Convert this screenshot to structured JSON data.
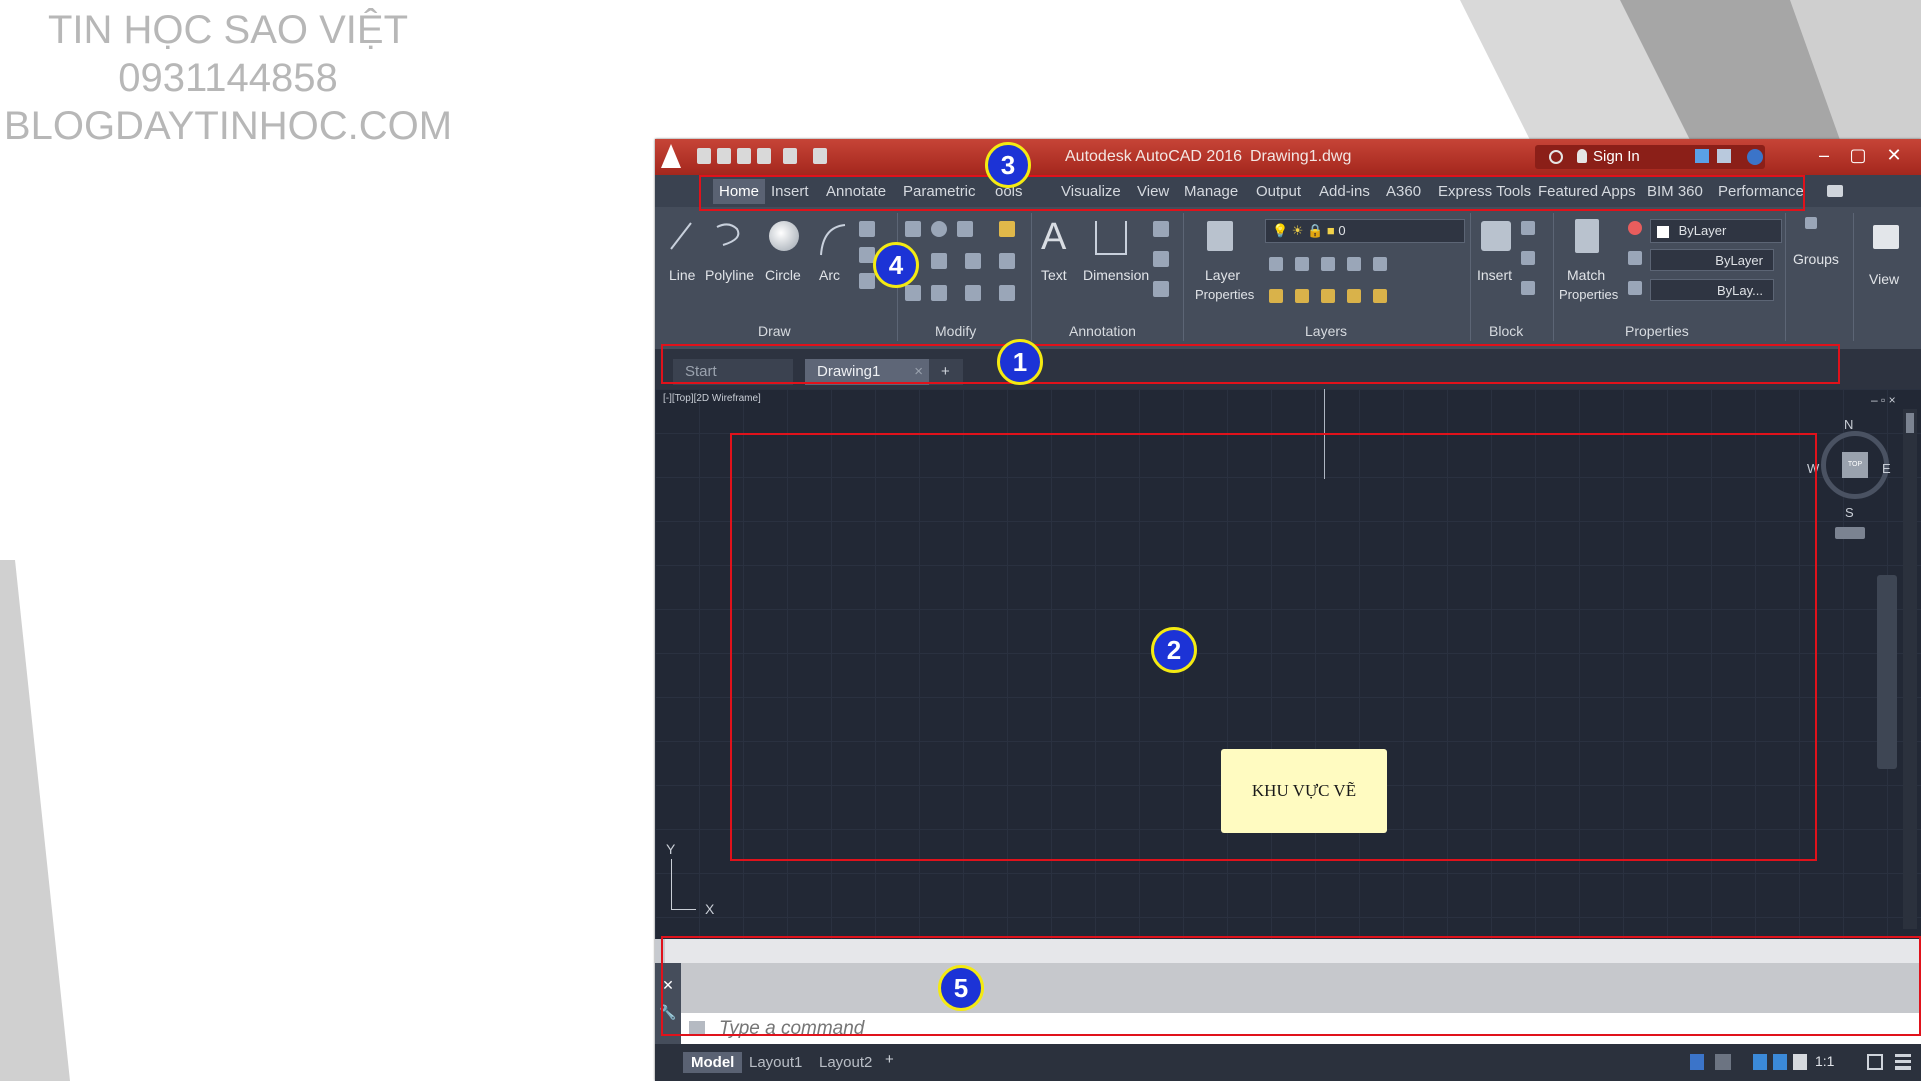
{
  "watermark": {
    "line1": "TIN HỌC SAO VIỆT",
    "line2": "0931144858",
    "line3": "BLOGDAYTINHOC.COM"
  },
  "window": {
    "title": "Autodesk AutoCAD 2016",
    "document": "Drawing1.dwg",
    "signin_label": "Sign In"
  },
  "menu_tabs": [
    "Home",
    "Insert",
    "Annotate",
    "Parametric",
    "ools",
    "Visualize",
    "View",
    "Manage",
    "Output",
    "Add-ins",
    "A360",
    "Express Tools",
    "Featured Apps",
    "BIM 360",
    "Performance"
  ],
  "ribbon": {
    "draw_tools": [
      "Line",
      "Polyline",
      "Circle",
      "Arc"
    ],
    "text_label": "Text",
    "dimension_label": "Dimension",
    "layer_props_label": "Layer",
    "layer_props_label2": "Properties",
    "layer_value": "0",
    "insert_label": "Insert",
    "match_label": "Match",
    "match_label2": "Properties",
    "bylayer_color": "ByLayer",
    "bylayer_lineweight": "ByLayer",
    "bylayer_linetype": "ByLay...",
    "groups_label": "Groups",
    "view_label": "View",
    "panels": [
      "Draw",
      "Modify",
      "Annotation",
      "Layers",
      "Block",
      "Properties"
    ]
  },
  "file_tabs": {
    "start": "Start",
    "drawing": "Drawing1",
    "plus": "+"
  },
  "viewport": {
    "label": "[-][Top][2D Wireframe]",
    "drawing_area_label": "KHU VỰC VẼ",
    "compass": {
      "n": "N",
      "s": "S",
      "e": "E",
      "w": "W",
      "top": "TOP"
    },
    "axis_x": "X",
    "axis_y": "Y"
  },
  "command": {
    "placeholder": "Type a command"
  },
  "layout_tabs": [
    "Model",
    "Layout1",
    "Layout2"
  ],
  "status": {
    "scale": "1:1"
  },
  "callouts": [
    "1",
    "2",
    "3",
    "4",
    "5"
  ],
  "colors": {
    "highlight_box": "#e0121b",
    "callout_fill": "#1c33d6",
    "callout_border": "#f4ea12",
    "note_fill": "#fffbc1"
  }
}
